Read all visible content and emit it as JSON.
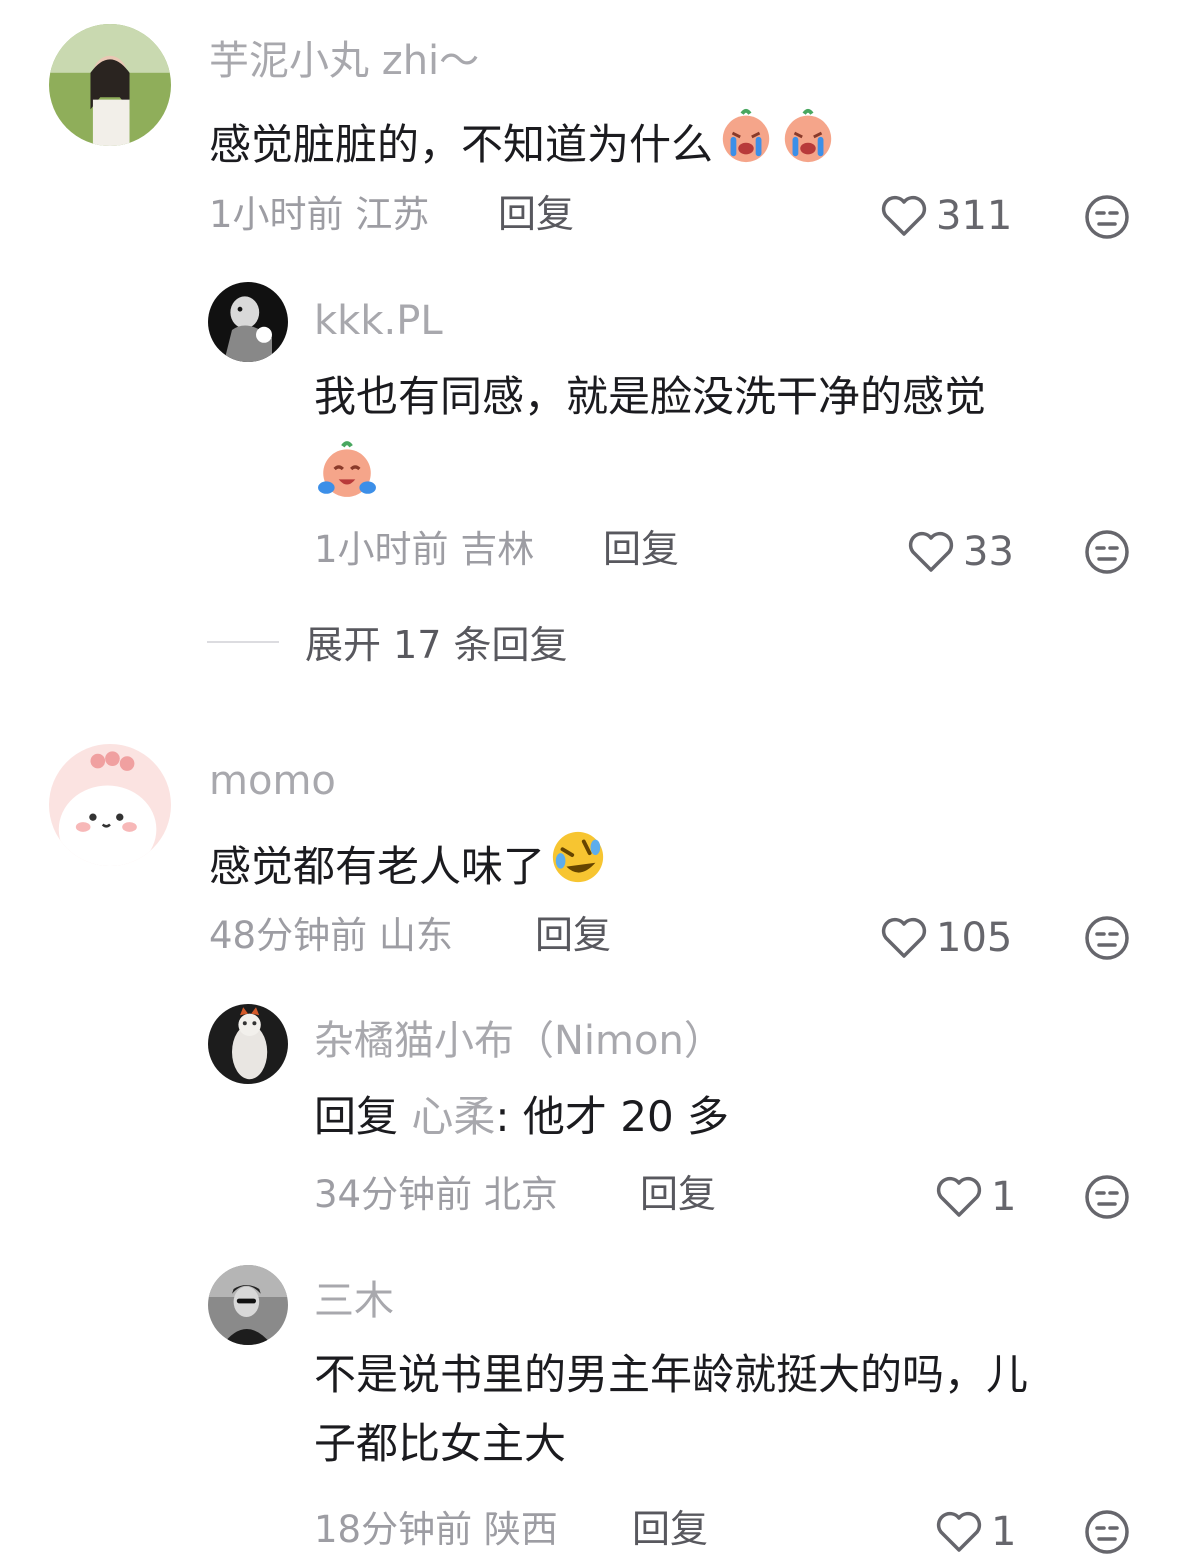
{
  "comments": [
    {
      "user": "芋泥小丸 zhi～",
      "text": "感觉脏脏的，不知道为什么",
      "emojis": [
        "crying-face-emoji",
        "crying-face-emoji"
      ],
      "time": "1小时前",
      "location": "江苏",
      "reply_label": "回复",
      "likes": "311",
      "replies": [
        {
          "user": "kkk.PL",
          "text": "我也有同感，就是脸没洗干净的感觉",
          "emojis": [
            "laugh-cry-face-emoji"
          ],
          "time": "1小时前",
          "location": "吉林",
          "reply_label": "回复",
          "likes": "33"
        }
      ],
      "expand_label": "展开 17 条回复"
    },
    {
      "user": "momo",
      "text": "感觉都有老人味了",
      "emojis": [
        "rolling-on-floor-laughing-emoji"
      ],
      "time": "48分钟前",
      "location": "山东",
      "reply_label": "回复",
      "likes": "105",
      "replies": [
        {
          "user": "杂橘猫小布（Nimon）",
          "reply_prefix": "回复",
          "mention": "心柔",
          "text": ": 他才 20 多",
          "time": "34分钟前",
          "location": "北京",
          "reply_label": "回复",
          "likes": "1"
        },
        {
          "user": "三木",
          "text_line1": "不是说书里的男主年龄就挺大的吗，儿",
          "text_line2": "子都比女主大",
          "time": "18分钟前",
          "location": "陕西",
          "reply_label": "回复",
          "likes": "1"
        }
      ]
    }
  ],
  "colors": {
    "username": "#a8a8ad",
    "text": "#1b1b1f",
    "meta": "#9d9da3"
  }
}
